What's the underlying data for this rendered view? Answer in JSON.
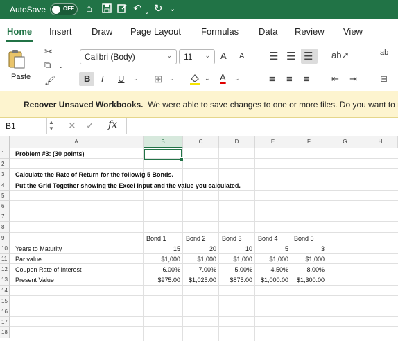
{
  "titlebar": {
    "autosave_label": "AutoSave",
    "toggle_label": "OFF",
    "qa_icons": [
      "home-icon",
      "save-icon",
      "edit-icon",
      "undo-icon",
      "redo-icon",
      "more-icon"
    ],
    "bg_color": "#217346"
  },
  "tabs": [
    {
      "label": "Home",
      "active": true
    },
    {
      "label": "Insert",
      "active": false
    },
    {
      "label": "Draw",
      "active": false
    },
    {
      "label": "Page Layout",
      "active": false
    },
    {
      "label": "Formulas",
      "active": false
    },
    {
      "label": "Data",
      "active": false
    },
    {
      "label": "Review",
      "active": false
    },
    {
      "label": "View",
      "active": false
    }
  ],
  "ribbon": {
    "paste_label": "Paste",
    "font_name": "Calibri (Body)",
    "font_size": "11",
    "grow_font": "A",
    "shrink_font": "A",
    "bold": "B",
    "italic": "I",
    "underline": "U",
    "font_color_letter": "A",
    "wrap_label": "ab"
  },
  "banner": {
    "title": "Recover Unsaved Workbooks.",
    "text": "We were able to save changes to one or more files. Do you want to re"
  },
  "formula_bar": {
    "name_box": "B1",
    "fx": "fx",
    "value": ""
  },
  "grid": {
    "columns": [
      "A",
      "B",
      "C",
      "D",
      "E",
      "F",
      "G",
      "H"
    ],
    "selected_column": "B",
    "rows": [
      "1",
      "2",
      "3",
      "4",
      "5",
      "6",
      "7",
      "8",
      "9",
      "10",
      "11",
      "12",
      "13",
      "14",
      "15",
      "16",
      "17",
      "18"
    ],
    "cells": {
      "A1": "Problem #3: (30 points)",
      "A3": "Calculate the Rate of Return for the followig 5 Bonds.",
      "A4": "Put the Grid Together showing the Excel Input and the value you calculated.",
      "A10": "Years to Maturity",
      "A11": "Par value",
      "A12": "Coupon Rate of Interest",
      "A13": "Present Value"
    },
    "bond_headers": [
      "Bond 1",
      "Bond 2",
      "Bond 3",
      "Bond 4",
      "Bond 5"
    ],
    "years_to_maturity": [
      "15",
      "20",
      "10",
      "5",
      "3"
    ],
    "par_value": [
      "$1,000",
      "$1,000",
      "$1,000",
      "$1,000",
      "$1,000"
    ],
    "coupon_rate": [
      "6.00%",
      "7.00%",
      "5.00%",
      "4.50%",
      "8.00%"
    ],
    "present_value": [
      "$975.00",
      "$1,025.00",
      "$875.00",
      "$1,000.00",
      "$1,300.00"
    ]
  }
}
